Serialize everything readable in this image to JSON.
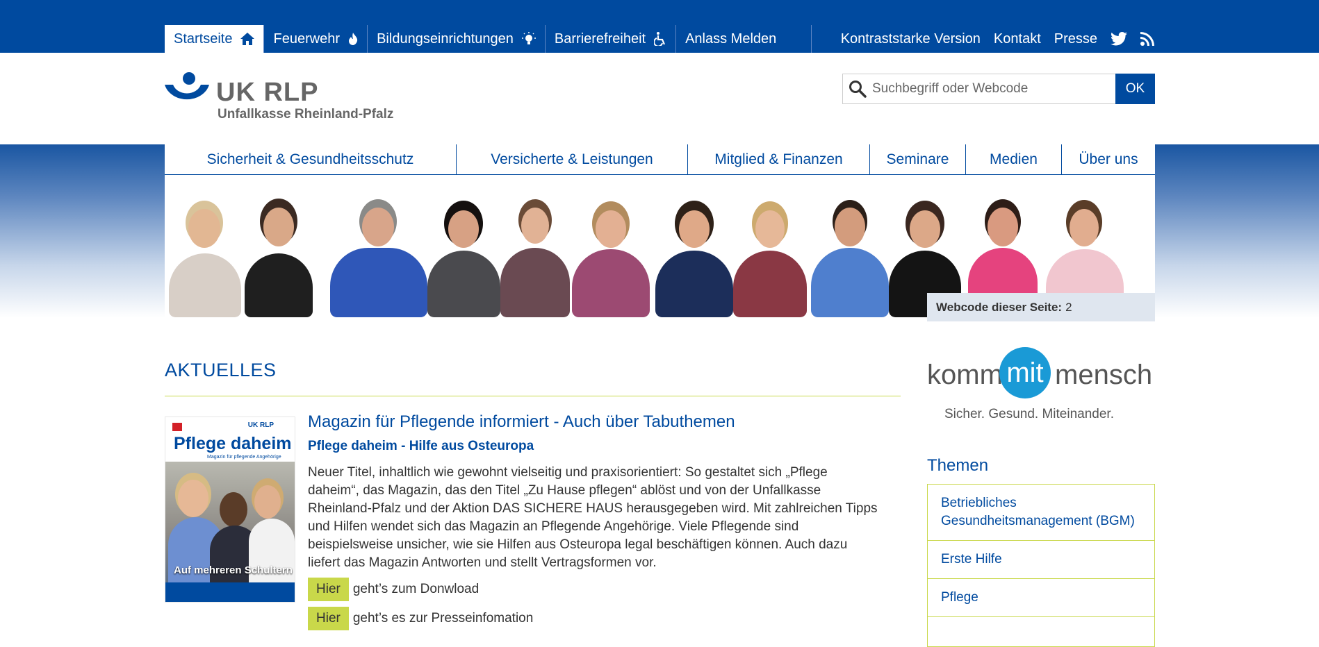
{
  "topnav": [
    {
      "label": "Startseite",
      "icon": "home-icon"
    },
    {
      "label": "Feuerwehr",
      "icon": "fire-icon"
    },
    {
      "label": "Bildungseinrichtungen",
      "icon": "lightbulb-icon"
    },
    {
      "label": "Barrierefreiheit",
      "icon": "wheelchair-icon"
    },
    {
      "label": "Anlass Melden",
      "icon": ""
    }
  ],
  "toplinks": {
    "contrast": "Kontraststarke Version",
    "contact": "Kontakt",
    "press": "Presse"
  },
  "logo": {
    "title": "UK RLP",
    "subtitle": "Unfallkasse Rheinland-Pfalz"
  },
  "search": {
    "placeholder": "Suchbegriff oder Webcode",
    "button": "OK"
  },
  "mainnav": [
    "Sicherheit & Gesundheitsschutz",
    "Versicherte & Leistungen",
    "Mitglied & Finanzen",
    "Seminare",
    "Medien",
    "Über uns"
  ],
  "webcode": {
    "label": "Webcode dieser Seite:",
    "value": "2"
  },
  "section_title": "AKTUELLES",
  "article": {
    "title": "Magazin für Pflegende informiert - Auch über Tabuthemen",
    "subtitle": "Pflege daheim - Hilfe aus Osteuropa",
    "body": "Neuer Titel, inhaltlich wie gewohnt vielseitig und praxisorientiert: So gestaltet sich „Pflege daheim“, das Magazin, das den Titel „Zu Hause pflegen“ ablöst und von der Unfallkasse Rheinland-Pfalz und der Aktion DAS SICHERE HAUS herausgegeben wird.  Mit zahlreichen  Tipps und Hilfen wendet sich das Magazin an Pflegende Angehörige. Viele Pflegende sind beispielsweise unsicher, wie sie Hilfen aus Osteuropa legal beschäftigen können. Auch dazu liefert das Magazin Antworten und stellt Vertragsformen vor.",
    "link1": {
      "button": "Hier",
      "text": "geht’s zum Donwload"
    },
    "link2": {
      "button": "Hier",
      "text": "geht’s es zur Presseinfomation"
    }
  },
  "magazine": {
    "brand": "UK RLP",
    "title": "Pflege daheim",
    "tagline": "Magazin für pflegende Angehörige",
    "cover_line": "Auf mehreren Schultern"
  },
  "kommmit": {
    "left": "komm",
    "mid": "mit",
    "right": "mensch",
    "tagline": "Sicher. Gesund. Miteinander."
  },
  "themen": {
    "title": "Themen",
    "items": [
      "Betriebliches Gesundheitsmanagement (BGM)",
      "Erste Hilfe",
      "Pflege"
    ]
  },
  "colors": {
    "primary": "#004a9f",
    "accent": "#c9d84a",
    "kmm_blue": "#1a9ad6"
  }
}
